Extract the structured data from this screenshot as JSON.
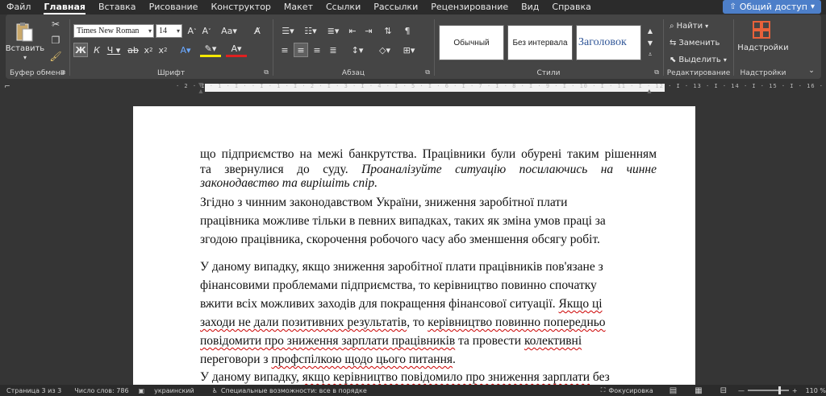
{
  "menu": {
    "tabs": [
      "Файл",
      "Главная",
      "Вставка",
      "Рисование",
      "Конструктор",
      "Макет",
      "Ссылки",
      "Рассылки",
      "Рецензирование",
      "Вид",
      "Справка"
    ],
    "active": "Главная",
    "share_label": "Общий доступ"
  },
  "ribbon": {
    "clipboard": {
      "paste_label": "Вставить",
      "group_label": "Буфер обмена"
    },
    "font": {
      "name": "Times New Roman",
      "size": "14",
      "group_label": "Шрифт"
    },
    "paragraph": {
      "group_label": "Абзац"
    },
    "styles": {
      "items": [
        "Обычный",
        "Без интервала",
        "Заголовок"
      ],
      "group_label": "Стили"
    },
    "editing": {
      "find": "Найти",
      "replace": "Заменить",
      "select": "Выделить",
      "group_label": "Редактирование"
    },
    "addins": {
      "button_label": "Надстройки",
      "group_label": "Надстройки"
    }
  },
  "ruler": {
    "marks": "· 2 · I · 1 · I ·   · I · 1 · I · 2 · I · 3 · I · 4 · I · 5 · I · 6 · I · 7 · I · 8 · I · 9 · I · 10 · I · 11 · I · 12 · I · 13 · I · 14 · I · 15 · I · 16 · I · 17 ·"
  },
  "document": {
    "p1_line1": "що підприємство на межі банкрутства. Працівники були обурені таким рішенням",
    "p1_line2a": "та звернулися до суду. ",
    "p1_line2b": "Проаналізуйте ситуацію посилаючись на чинне",
    "p1_line3": "законодавство та вирішіть спір.",
    "p2_lines": [
      "Згідно з чинним законодавством України, зниження заробітної плати",
      "працівника можливе тільки в певних випадках, таких як зміна умов праці за",
      "згодою працівника, скорочення робочого часу або зменшення обсягу робіт."
    ],
    "p3_line1": "У даному випадку, якщо зниження заробітної плати працівників пов'язане з",
    "p3_line2": "фінансовими проблемами підприємства, то керівництво повинно спочатку",
    "p3_line3": "вжити всіх можливих заходів для покращення фінансової ситуації.",
    "p3_line3_squig": "Якщо ці",
    "p3_line4_squig1": "заходи не дали позитивних результатів",
    "p3_line4_b": ", то ",
    "p3_line4_squig2": "керівництво повинно попередньо",
    "p3_line5_squig": "повідомити про зниження зарплати працівників",
    "p3_line5_b": " та провести ",
    "p3_line5_squig2": "колективні",
    "p3_line6_a": "переговори з ",
    "p3_line6_squig": "профспілкою щодо цього питання",
    "p3_line6_b": ".",
    "p4_line1_a": "У даному випадку, ",
    "p4_line1_squig": "якщо керівництво повідомило про зниження зарплати",
    "p4_line1_b": " без"
  },
  "status": {
    "page": "Страница 3 из 3",
    "words": "Число слов: 786",
    "language": "украинский",
    "accessibility": "Специальные возможности: все в порядке",
    "focus": "Фокусировка",
    "zoom": "110 %"
  }
}
